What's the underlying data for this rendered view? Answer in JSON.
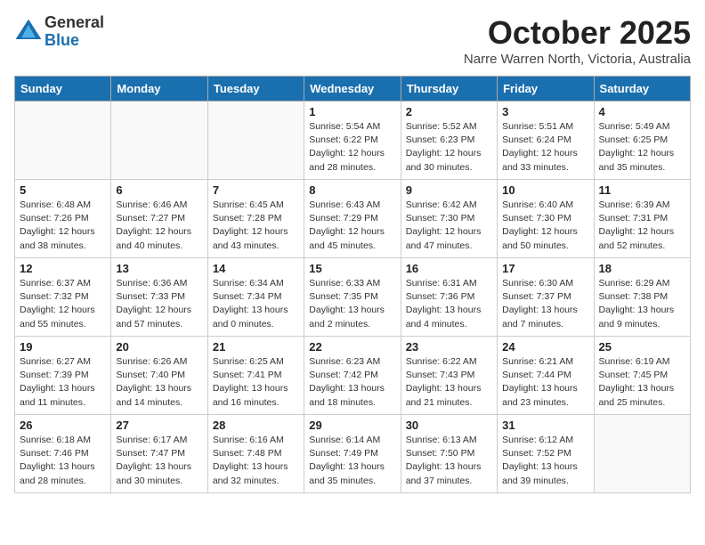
{
  "logo": {
    "general": "General",
    "blue": "Blue"
  },
  "title": "October 2025",
  "location": "Narre Warren North, Victoria, Australia",
  "weekdays": [
    "Sunday",
    "Monday",
    "Tuesday",
    "Wednesday",
    "Thursday",
    "Friday",
    "Saturday"
  ],
  "weeks": [
    [
      {
        "day": "",
        "info": ""
      },
      {
        "day": "",
        "info": ""
      },
      {
        "day": "",
        "info": ""
      },
      {
        "day": "1",
        "info": "Sunrise: 5:54 AM\nSunset: 6:22 PM\nDaylight: 12 hours\nand 28 minutes."
      },
      {
        "day": "2",
        "info": "Sunrise: 5:52 AM\nSunset: 6:23 PM\nDaylight: 12 hours\nand 30 minutes."
      },
      {
        "day": "3",
        "info": "Sunrise: 5:51 AM\nSunset: 6:24 PM\nDaylight: 12 hours\nand 33 minutes."
      },
      {
        "day": "4",
        "info": "Sunrise: 5:49 AM\nSunset: 6:25 PM\nDaylight: 12 hours\nand 35 minutes."
      }
    ],
    [
      {
        "day": "5",
        "info": "Sunrise: 6:48 AM\nSunset: 7:26 PM\nDaylight: 12 hours\nand 38 minutes."
      },
      {
        "day": "6",
        "info": "Sunrise: 6:46 AM\nSunset: 7:27 PM\nDaylight: 12 hours\nand 40 minutes."
      },
      {
        "day": "7",
        "info": "Sunrise: 6:45 AM\nSunset: 7:28 PM\nDaylight: 12 hours\nand 43 minutes."
      },
      {
        "day": "8",
        "info": "Sunrise: 6:43 AM\nSunset: 7:29 PM\nDaylight: 12 hours\nand 45 minutes."
      },
      {
        "day": "9",
        "info": "Sunrise: 6:42 AM\nSunset: 7:30 PM\nDaylight: 12 hours\nand 47 minutes."
      },
      {
        "day": "10",
        "info": "Sunrise: 6:40 AM\nSunset: 7:30 PM\nDaylight: 12 hours\nand 50 minutes."
      },
      {
        "day": "11",
        "info": "Sunrise: 6:39 AM\nSunset: 7:31 PM\nDaylight: 12 hours\nand 52 minutes."
      }
    ],
    [
      {
        "day": "12",
        "info": "Sunrise: 6:37 AM\nSunset: 7:32 PM\nDaylight: 12 hours\nand 55 minutes."
      },
      {
        "day": "13",
        "info": "Sunrise: 6:36 AM\nSunset: 7:33 PM\nDaylight: 12 hours\nand 57 minutes."
      },
      {
        "day": "14",
        "info": "Sunrise: 6:34 AM\nSunset: 7:34 PM\nDaylight: 13 hours\nand 0 minutes."
      },
      {
        "day": "15",
        "info": "Sunrise: 6:33 AM\nSunset: 7:35 PM\nDaylight: 13 hours\nand 2 minutes."
      },
      {
        "day": "16",
        "info": "Sunrise: 6:31 AM\nSunset: 7:36 PM\nDaylight: 13 hours\nand 4 minutes."
      },
      {
        "day": "17",
        "info": "Sunrise: 6:30 AM\nSunset: 7:37 PM\nDaylight: 13 hours\nand 7 minutes."
      },
      {
        "day": "18",
        "info": "Sunrise: 6:29 AM\nSunset: 7:38 PM\nDaylight: 13 hours\nand 9 minutes."
      }
    ],
    [
      {
        "day": "19",
        "info": "Sunrise: 6:27 AM\nSunset: 7:39 PM\nDaylight: 13 hours\nand 11 minutes."
      },
      {
        "day": "20",
        "info": "Sunrise: 6:26 AM\nSunset: 7:40 PM\nDaylight: 13 hours\nand 14 minutes."
      },
      {
        "day": "21",
        "info": "Sunrise: 6:25 AM\nSunset: 7:41 PM\nDaylight: 13 hours\nand 16 minutes."
      },
      {
        "day": "22",
        "info": "Sunrise: 6:23 AM\nSunset: 7:42 PM\nDaylight: 13 hours\nand 18 minutes."
      },
      {
        "day": "23",
        "info": "Sunrise: 6:22 AM\nSunset: 7:43 PM\nDaylight: 13 hours\nand 21 minutes."
      },
      {
        "day": "24",
        "info": "Sunrise: 6:21 AM\nSunset: 7:44 PM\nDaylight: 13 hours\nand 23 minutes."
      },
      {
        "day": "25",
        "info": "Sunrise: 6:19 AM\nSunset: 7:45 PM\nDaylight: 13 hours\nand 25 minutes."
      }
    ],
    [
      {
        "day": "26",
        "info": "Sunrise: 6:18 AM\nSunset: 7:46 PM\nDaylight: 13 hours\nand 28 minutes."
      },
      {
        "day": "27",
        "info": "Sunrise: 6:17 AM\nSunset: 7:47 PM\nDaylight: 13 hours\nand 30 minutes."
      },
      {
        "day": "28",
        "info": "Sunrise: 6:16 AM\nSunset: 7:48 PM\nDaylight: 13 hours\nand 32 minutes."
      },
      {
        "day": "29",
        "info": "Sunrise: 6:14 AM\nSunset: 7:49 PM\nDaylight: 13 hours\nand 35 minutes."
      },
      {
        "day": "30",
        "info": "Sunrise: 6:13 AM\nSunset: 7:50 PM\nDaylight: 13 hours\nand 37 minutes."
      },
      {
        "day": "31",
        "info": "Sunrise: 6:12 AM\nSunset: 7:52 PM\nDaylight: 13 hours\nand 39 minutes."
      },
      {
        "day": "",
        "info": ""
      }
    ]
  ]
}
